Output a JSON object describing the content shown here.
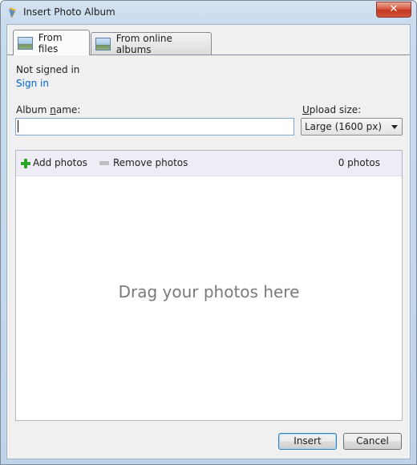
{
  "window": {
    "title": "Insert Photo Album",
    "close_label": "✕"
  },
  "tabs": [
    {
      "label": "From files",
      "active": true
    },
    {
      "label": "From online albums",
      "active": false
    }
  ],
  "account": {
    "status": "Not signed in",
    "sign_in_link": "Sign in"
  },
  "album": {
    "label": "Album name:",
    "value": ""
  },
  "upload": {
    "label": "Upload size:",
    "selected": "Large (1600 px)"
  },
  "photos": {
    "add_label": "Add photos",
    "remove_label": "Remove photos",
    "count": "0 photos",
    "drop_hint": "Drag your photos here"
  },
  "buttons": {
    "insert": "Insert",
    "cancel": "Cancel"
  },
  "icons": {
    "title": "app-icon",
    "tab": "picture-icon",
    "add": "plus-icon",
    "remove": "minus-icon",
    "select": "chevron-down-icon"
  },
  "colors": {
    "link": "#0066cc",
    "accent_border": "#3c7fb1",
    "add_icon": "#2fa52c"
  }
}
